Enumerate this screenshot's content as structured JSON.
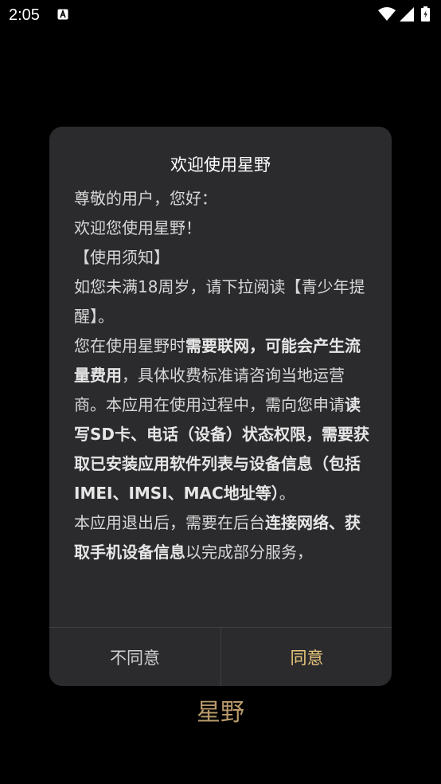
{
  "status_bar": {
    "time": "2:05",
    "icons": [
      "notification-a-icon",
      "wifi-icon",
      "signal-icon",
      "battery-icon"
    ]
  },
  "dialog": {
    "title": "欢迎使用星野",
    "body": {
      "greeting": "尊敬的用户，您好：",
      "welcome": "欢迎您使用星野！",
      "notice_header": "【使用须知】",
      "age_notice": "如您未满18周岁，请下拉阅读【青少年提醒】。",
      "network_prefix": "您在使用星野时",
      "network_bold": "需要联网，可能会产生流量费用",
      "network_suffix": "，具体收费标准请咨询当地运营商。本应用在使用过程中，需向您申请",
      "permissions_bold": "读写SD卡、电话（设备）状态权限，需要获取已安装应用软件列表与设备信息（包括IMEI、IMSI、MAC地址等）",
      "permissions_suffix": "。",
      "exit_prefix": "本应用退出后，需要在后台",
      "exit_bold": "连接网络、获取手机设备信息",
      "exit_suffix": "以完成部分服务，"
    },
    "buttons": {
      "disagree": "不同意",
      "agree": "同意"
    }
  },
  "logo": {
    "text": "星野"
  },
  "colors": {
    "background": "#000000",
    "dialog": "#2b2b2e",
    "accent": "#e8c77a",
    "logo": "#b89a6b"
  }
}
